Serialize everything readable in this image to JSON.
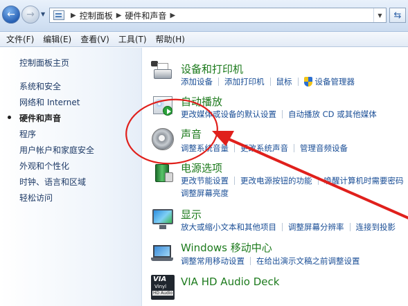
{
  "address": {
    "crumbs": [
      "控制面板",
      "硬件和声音"
    ]
  },
  "menu": [
    "文件(F)",
    "编辑(E)",
    "查看(V)",
    "工具(T)",
    "帮助(H)"
  ],
  "sidebar": {
    "items": [
      "控制面板主页",
      "系统和安全",
      "网络和 Internet",
      "硬件和声音",
      "程序",
      "用户帐户和家庭安全",
      "外观和个性化",
      "时钟、语言和区域",
      "轻松访问"
    ]
  },
  "categories": {
    "devices": {
      "title": "设备和打印机",
      "links": [
        "添加设备",
        "添加打印机",
        "鼠标",
        "设备管理器"
      ]
    },
    "autoplay": {
      "title": "自动播放",
      "links": [
        "更改媒体或设备的默认设置",
        "自动播放 CD 或其他媒体"
      ]
    },
    "sound": {
      "title": "声音",
      "links": [
        "调整系统音量",
        "更改系统声音",
        "管理音频设备"
      ]
    },
    "power": {
      "title": "电源选项",
      "links": [
        "更改节能设置",
        "更改电源按钮的功能",
        "唤醒计算机时需要密码"
      ],
      "links2": [
        "调整屏幕亮度"
      ]
    },
    "display": {
      "title": "显示",
      "links": [
        "放大或缩小文本和其他项目",
        "调整屏幕分辨率",
        "连接到投影"
      ]
    },
    "mobility": {
      "title": "Windows 移动中心",
      "links": [
        "调整常用移动设置",
        "在给出演示文稿之前调整设置"
      ]
    },
    "via": {
      "title": "VIA HD Audio Deck",
      "logo_text": [
        "VIA",
        "Vinyl",
        "HD Audio"
      ]
    }
  },
  "icons": {
    "back": "back-arrow-icon",
    "forward": "forward-arrow-icon",
    "refresh": "refresh-icon",
    "shield": "uac-shield-icon"
  },
  "colors": {
    "title_green": "#1c7a1c",
    "link_blue": "#1a4e96",
    "annotation_red": "#e0201c"
  }
}
